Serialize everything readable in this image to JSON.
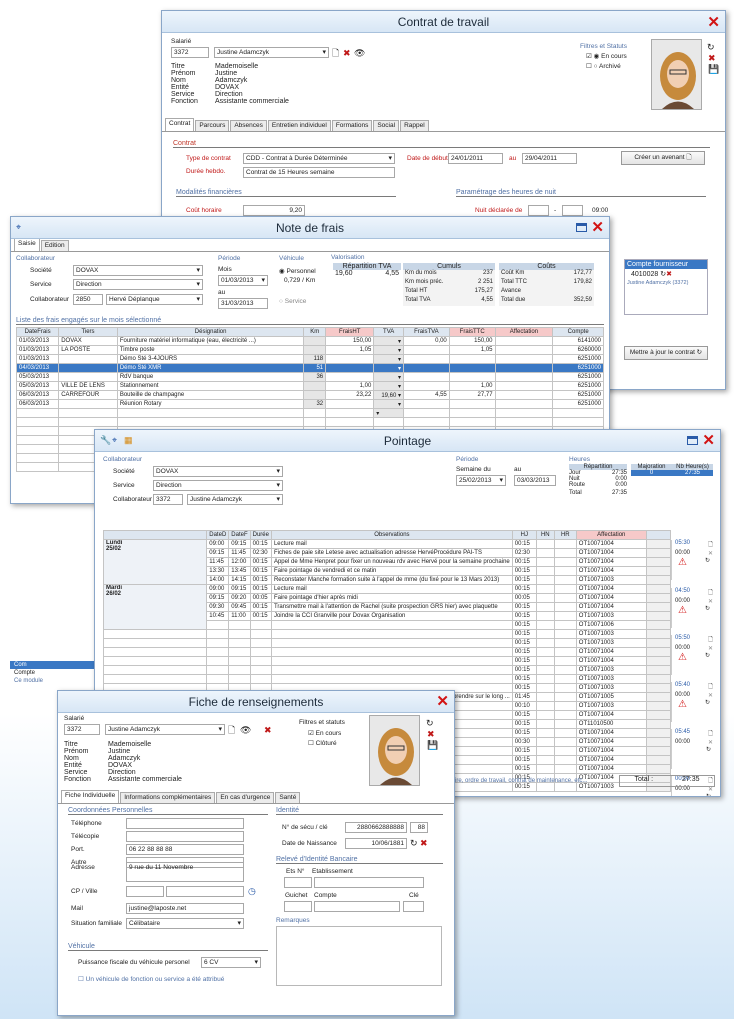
{
  "contrat": {
    "title": "Contrat de travail",
    "salarie_label": "Salarié",
    "id": "3372",
    "name": "Justine Adamczyk",
    "fields": [
      {
        "k": "Titre",
        "v": "Mademoiselle"
      },
      {
        "k": "Prénom",
        "v": "Justine"
      },
      {
        "k": "Nom",
        "v": "Adamczyk"
      },
      {
        "k": "Entité",
        "v": "DOVAX"
      },
      {
        "k": "Service",
        "v": "Direction"
      },
      {
        "k": "Fonction",
        "v": "Assistante commerciale"
      }
    ],
    "filtres": "Filtres et Statuts",
    "en_cours": "En cours",
    "archive": "Archivé",
    "tabs": [
      "Contrat",
      "Parcours",
      "Absences",
      "Entretien individuel",
      "Formations",
      "Social",
      "Rappel"
    ],
    "sec_contrat": "Contrat",
    "type_label": "Type de contrat",
    "type_val": "CDD - Contrat à Durée Déterminée",
    "duree_label": "Durée hebdo.",
    "duree_val": "Contrat de 15 Heures semaine",
    "debut_label": "Date de début",
    "debut_val": "24/01/2011",
    "au": "au",
    "fin_val": "29/04/2011",
    "avenant": "Créer un avenant",
    "sec_fin": "Modalités financières",
    "cout_label": "Coût horaire",
    "cout_val": "9,20",
    "sec_nuit": "Paramétrage des heures de nuit",
    "nuit_label": "Nuit déclarée de",
    "nuit_to": "09:00",
    "fournisseur_label": "Compte fournisseur",
    "fournisseur_val": "4010028",
    "fournisseur_name": "Justine Adamczyk (3372)",
    "maj": "Mettre à jour le contrat"
  },
  "frais": {
    "title": "Note de frais",
    "tabs": [
      "Saisie",
      "Edition"
    ],
    "collab": "Collaborateur",
    "societe_l": "Société",
    "societe": "DOVAX",
    "service_l": "Service",
    "service": "Direction",
    "collab_l": "Collaborateur",
    "collab_id": "2850",
    "collab_name": "Hervé Déplanque",
    "periode": "Période",
    "mois": "Mois",
    "mois_val": "01/03/2013",
    "au": "au",
    "au_val": "31/03/2013",
    "vehicule": "Véhicule",
    "personnel": "Personnel",
    "taux": "0,729 / Km",
    "service_opt": "Service",
    "valorisation": "Valorisation",
    "rep_tva": "Répartition TVA",
    "rep_a": "19,60",
    "rep_b": "4,55",
    "cumuls": "Cumuls",
    "couts": "Coûts",
    "cumuls_rows": [
      [
        "Km du mois",
        "237"
      ],
      [
        "Km mois préc.",
        "2 251"
      ],
      [
        "Total HT",
        "175,27"
      ],
      [
        "Total TVA",
        "4,55"
      ]
    ],
    "couts_rows": [
      [
        "Coût Km",
        "172,77"
      ],
      [
        "Total TTC",
        "179,82"
      ],
      [
        "Avance",
        ""
      ],
      [
        "Total due",
        "352,59"
      ]
    ],
    "list_title": "Liste des frais engagés sur le mois sélectionné",
    "cols": [
      "DateFrais",
      "Tiers",
      "Désignation",
      "Km",
      "FraisHT",
      "TVA",
      "FraisTVA",
      "FraisTTC",
      "Affectation",
      "Compte"
    ],
    "rows": [
      [
        "01/03/2013",
        "DOVAX",
        "Fourniture matériel informatique (eau, électricité ...)",
        "",
        "150,00",
        "",
        "0,00",
        "150,00",
        "",
        "6141000"
      ],
      [
        "01/03/2013",
        "LA POSTE",
        "Timbre poste",
        "",
        "1,05",
        "",
        "",
        "1,05",
        "",
        "6260000"
      ],
      [
        "01/03/2013",
        "",
        "Démo Sté 3-4JOURS",
        "118",
        "",
        "",
        "",
        "",
        "",
        "6251000"
      ],
      [
        "04/03/2013",
        "",
        "Démo Sté XMR",
        "51",
        "",
        "",
        "",
        "",
        "",
        "6251000"
      ],
      [
        "05/03/2013",
        "",
        "RdV banque",
        "36",
        "",
        "",
        "",
        "",
        "",
        "6251000"
      ],
      [
        "05/03/2013",
        "VILLE DE LENS",
        "Stationnement",
        "",
        "1,00",
        "",
        "",
        "1,00",
        "",
        "6251000"
      ],
      [
        "06/03/2013",
        "CARREFOUR",
        "Bouteille de champagne",
        "",
        "23,22",
        "19,60",
        "4,55",
        "27,77",
        "",
        "6251000"
      ],
      [
        "06/03/2013",
        "",
        "Réunion Rotary",
        "32",
        "",
        "",
        "",
        "",
        "",
        "6251000"
      ]
    ],
    "sel_row": 3
  },
  "pointage": {
    "title": "Pointage",
    "collab": "Collaborateur",
    "societe_l": "Société",
    "societe": "DOVAX",
    "service_l": "Service",
    "service": "Direction",
    "collab_l": "Collaborateur",
    "collab_id": "3372",
    "collab_name": "Justine Adamczyk",
    "periode": "Période",
    "semaine": "Semaine du",
    "semaine_val": "25/02/2013",
    "au": "au",
    "au_val": "03/03/2013",
    "heures": "Heures",
    "repartition": "Répartition",
    "jour": "Jour",
    "jour_v": "27:35",
    "nuit": "Nuit",
    "nuit_v": "0:00",
    "route": "Route",
    "route_v": "0:00",
    "total": "Total",
    "total_v": "27:35",
    "majoration": "Majoration",
    "maj_v": "0",
    "nbh": "Nb Heure(s)",
    "nbh_v": "27:35",
    "cols": [
      "DateD",
      "DateF",
      "Durée",
      "Observations",
      "HJ",
      "HN",
      "HR",
      "Affectation",
      "Jour/Nuit"
    ],
    "days": [
      {
        "d": "Lundi",
        "n": "25/02",
        "jn": [
          "05:30",
          "00:00"
        ],
        "rows": [
          [
            "09:00",
            "09:15",
            "00:15",
            "Lecture mail",
            "00:15",
            "OT10071004"
          ],
          [
            "09:15",
            "11:45",
            "02:30",
            "Fiches de paie site Letese avec actualisation adresse HervéProcédure PAI-TS",
            "02:30",
            "OT10071004"
          ],
          [
            "11:45",
            "12:00",
            "00:15",
            "Appel de Mme Henpret pour fixer un nouveau rdv avec Hervé pour la semaine prochaine",
            "00:15",
            "OT10071004"
          ],
          [
            "13:30",
            "13:45",
            "00:15",
            "Faire pointage de vendredi et ce matin",
            "00:15",
            "OT10071004"
          ],
          [
            "14:00",
            "14:15",
            "00:15",
            "Reconstater Manche formation suite à l'appel de mme (du fixé pour le 13 Mars 2013)",
            "00:15",
            "OT10071003"
          ]
        ]
      },
      {
        "d": "Mardi",
        "n": "26/02",
        "jn": [
          "04:50",
          "00:00"
        ],
        "rows": [
          [
            "09:00",
            "09:15",
            "00:15",
            "Lecture mail",
            "00:15",
            "OT10071004"
          ],
          [
            "09:15",
            "09:20",
            "00:05",
            "Faire pointage d'hier après midi",
            "00:05",
            "OT10071004"
          ],
          [
            "09:30",
            "09:45",
            "00:15",
            "Transmettre mail à l'attention de Rachel (suite prospection GRS hier) avec plaquette",
            "00:15",
            "OT10071004"
          ],
          [
            "10:45",
            "11:00",
            "00:15",
            "Joindre la CCI Granville pour Dovax Organisation",
            "00:15",
            "OT10071003"
          ],
          [
            "",
            "",
            "",
            "",
            "00:15",
            "OT10071006"
          ]
        ]
      }
    ],
    "extra_hj": [
      "00:15",
      "00:15",
      "00:15",
      "00:15",
      "00:15",
      "00:15",
      "00:15",
      "01:45",
      "00:10",
      "00:15",
      "00:15",
      "00:15",
      "00:30",
      "00:15",
      "00:15",
      "00:15",
      "00:15",
      "00:15"
    ],
    "extra_aff": [
      "OT10071003",
      "OT10071003",
      "OT10071004",
      "OT10071004",
      "OT10071003",
      "OT10071003",
      "OT10071003",
      "OT10071005",
      "OT10071003",
      "OT10071004",
      "OT11010500",
      "OT10071004",
      "OT10071004",
      "OT10071004",
      "OT10071004",
      "OT10071004",
      "OT10071004",
      "OT10071003"
    ],
    "extra_obs": [
      "a prendre sur le long ..."
    ],
    "jn_more": [
      [
        "05:50",
        "00:00"
      ],
      [
        "05:40",
        "00:00"
      ],
      [
        "05:45",
        "00:00"
      ],
      [
        "00:00",
        "00:00"
      ],
      [
        "00:00",
        "00:00"
      ]
    ],
    "footer_text": "ire, ordre de travail, contrat de maintenance, etc...",
    "total_label": "Total :",
    "total_val": "27:35"
  },
  "fiche": {
    "title": "Fiche de renseignements",
    "salarie": "Salarié",
    "id": "3372",
    "name": "Justine Adamczyk",
    "fields": [
      {
        "k": "Titre",
        "v": "Mademoiselle"
      },
      {
        "k": "Prénom",
        "v": "Justine"
      },
      {
        "k": "Nom",
        "v": "Adamczyk"
      },
      {
        "k": "Entité",
        "v": "DOVAX"
      },
      {
        "k": "Service",
        "v": "Direction"
      },
      {
        "k": "Fonction",
        "v": "Assistante commerciale"
      }
    ],
    "filtres": "Filtres et statuts",
    "en_cours": "En cours",
    "cloture": "Clôturé",
    "tabs": [
      "Fiche Individuelle",
      "Informations complémentaires",
      "En cas d'urgence",
      "Santé"
    ],
    "coord": "Coordonnées Personnelles",
    "tel": "Téléphone",
    "fax": "Télécopie",
    "port": "Port.",
    "port_v": "06 22 88 88 88",
    "autre": "Autre",
    "adresse": "Adresse",
    "adresse_v": "9 rue du 11 Novembre",
    "cp": "CP / Ville",
    "mail": "Mail",
    "mail_v": "justine@laposte.net",
    "situation": "Situation familiale",
    "situation_v": "Célibataire",
    "identite": "Identité",
    "secu": "N° de sécu / clé",
    "secu_v": "2880662888888",
    "secu_k": "88",
    "naiss": "Date de Naissance",
    "naiss_v": "10/06/1881",
    "rib": "Relevé d'Identité Bancaire",
    "ets": "Ets N°",
    "etab": "Etablissement",
    "guichet": "Guichet",
    "compte": "Compte",
    "cle": "Clé",
    "remarques": "Remarques",
    "vehicule": "Véhicule",
    "puissance": "Puissance fiscale du véhicule personel",
    "puissance_v": "6 CV",
    "vf": "Un véhicule de fonction ou service a été attribué"
  },
  "bg": {
    "com": "Com",
    "compte": "Compte",
    "module": "Ce module"
  }
}
